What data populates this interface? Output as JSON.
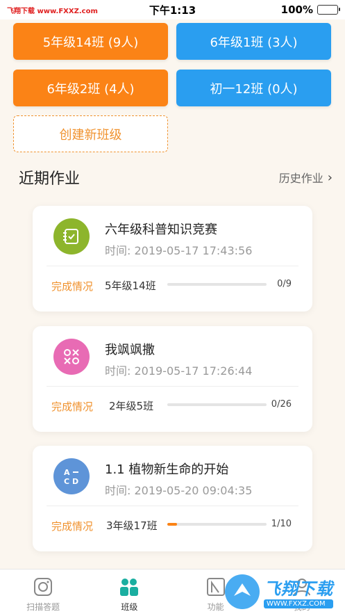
{
  "status_bar": {
    "site_watermark": "飞翔下载 www.FXXZ.com",
    "time": "下午1:13",
    "battery": "100%"
  },
  "classes": [
    {
      "label": "5年级14班 (9人)",
      "color": "#fb8316"
    },
    {
      "label": "6年级1班 (3人)",
      "color": "#2a9ef0"
    },
    {
      "label": "6年级2班 (4人)",
      "color": "#fb8316"
    },
    {
      "label": "初一12班 (0人)",
      "color": "#2a9ef0"
    }
  ],
  "create_class_label": "创建新班级",
  "recent": {
    "title": "近期作业",
    "history_label": "历史作业"
  },
  "assignments": [
    {
      "icon": "checklist-icon",
      "icon_color": "#8db52c",
      "title": "六年级科普知识竞赛",
      "time": "时间: 2019-05-17 17:43:56",
      "progress_label": "完成情况",
      "class_name": "5年级14班",
      "count": "0/9",
      "progress": 0
    },
    {
      "icon": "tic-tac-toe-icon",
      "icon_color": "#e86bb4",
      "title": "我飒飒撒",
      "time": "时间: 2019-05-17 17:26:44",
      "progress_label": "完成情况",
      "class_name": "2年级5班",
      "count": "0/26",
      "progress": 0
    },
    {
      "icon": "abcd-icon",
      "icon_color": "#5e94d8",
      "title": "1.1  植物新生命的开始",
      "time": "时间: 2019-05-20 09:04:35",
      "progress_label": "完成情况",
      "class_name": "3年级17班",
      "count": "1/10",
      "progress": 0.1
    }
  ],
  "tabs": [
    {
      "label": "扫描答题",
      "icon": "camera-icon",
      "active": false
    },
    {
      "label": "班级",
      "icon": "class-people-icon",
      "active": true
    },
    {
      "label": "功能",
      "icon": "function-icon",
      "active": false
    },
    {
      "label": "我的",
      "icon": "profile-icon",
      "active": false
    }
  ],
  "watermark": {
    "main": "飞翔下载",
    "sub": "WWW.FXXZ.COM"
  }
}
